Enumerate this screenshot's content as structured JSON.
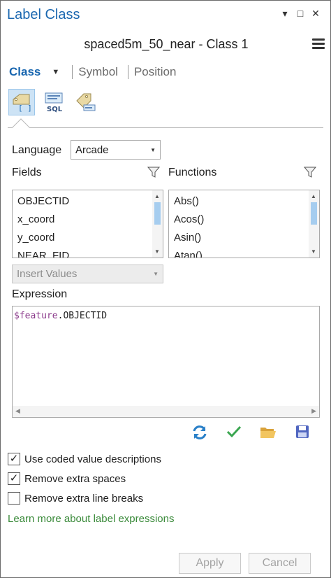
{
  "window": {
    "title": "Label Class",
    "controls": {
      "pin": "▾",
      "restore": "□",
      "close": "✕"
    }
  },
  "header": {
    "layer_class": "spaced5m_50_near - Class 1"
  },
  "tabs": [
    {
      "label": "Class",
      "active": true
    },
    {
      "label": "Symbol",
      "active": false
    },
    {
      "label": "Position",
      "active": false
    }
  ],
  "toolbar_icons": [
    "expression-icon",
    "sql-query-icon",
    "label-placement-icon"
  ],
  "language": {
    "label": "Language",
    "value": "Arcade"
  },
  "fields": {
    "label": "Fields",
    "items": [
      "OBJECTID",
      "x_coord",
      "y_coord",
      "NEAR_FID"
    ]
  },
  "functions": {
    "label": "Functions",
    "items": [
      "Abs()",
      "Acos()",
      "Asin()",
      "Atan()"
    ]
  },
  "insert_values": {
    "placeholder": "Insert Values"
  },
  "expression": {
    "label": "Expression",
    "keyword": "$feature",
    "property": ".OBJECTID"
  },
  "checkboxes": [
    {
      "label": "Use coded value descriptions",
      "checked": true
    },
    {
      "label": "Remove extra spaces",
      "checked": true
    },
    {
      "label": "Remove extra line breaks",
      "checked": false
    }
  ],
  "learn_more": "Learn more about label expressions",
  "buttons": {
    "apply": "Apply",
    "cancel": "Cancel"
  },
  "colors": {
    "accent": "#1a67b0",
    "link": "#3a8a3a",
    "verify": "#3aa650",
    "folder": "#e8b84a",
    "save": "#4a5fb8"
  }
}
